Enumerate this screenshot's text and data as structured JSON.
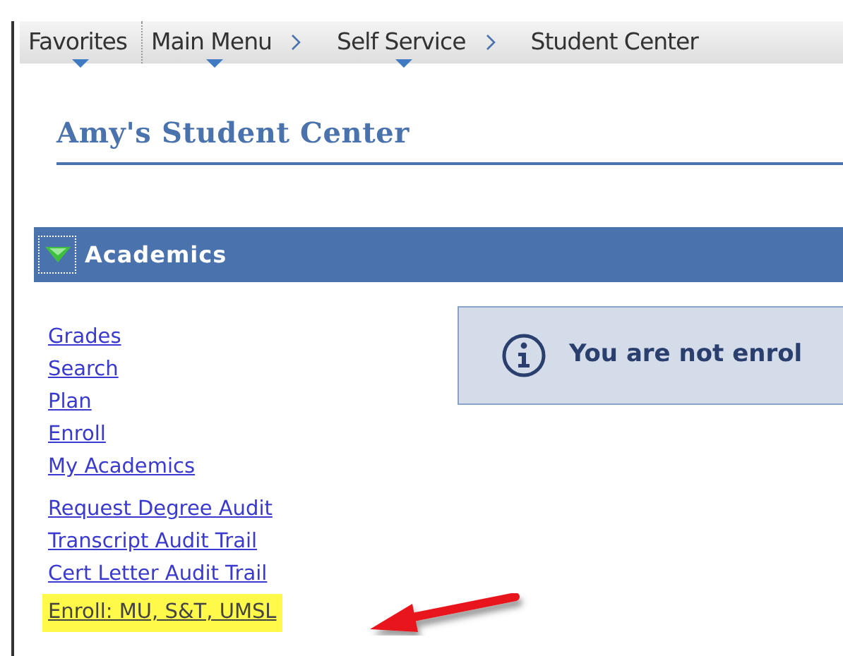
{
  "breadcrumb": [
    {
      "label": "Favorites",
      "has_menu": true
    },
    {
      "label": "Main Menu",
      "has_menu": true
    },
    {
      "label": "Self Service",
      "has_menu": true
    },
    {
      "label": "Student Center",
      "has_menu": false
    }
  ],
  "page_title": "Amy's Student Center",
  "section": {
    "title": "Academics",
    "expanded": true
  },
  "link_groups": [
    [
      {
        "label": "Grades",
        "highlighted": false
      },
      {
        "label": "Search",
        "highlighted": false
      },
      {
        "label": "Plan",
        "highlighted": false
      },
      {
        "label": "Enroll",
        "highlighted": false
      },
      {
        "label": "My Academics",
        "highlighted": false
      }
    ],
    [
      {
        "label": "Request Degree Audit",
        "highlighted": false
      },
      {
        "label": "Transcript Audit Trail",
        "highlighted": false
      },
      {
        "label": "Cert Letter Audit Trail",
        "highlighted": false
      },
      {
        "label": "Enroll: MU, S&T, UMSL",
        "highlighted": true
      }
    ]
  ],
  "info_message": "You are not enrol"
}
